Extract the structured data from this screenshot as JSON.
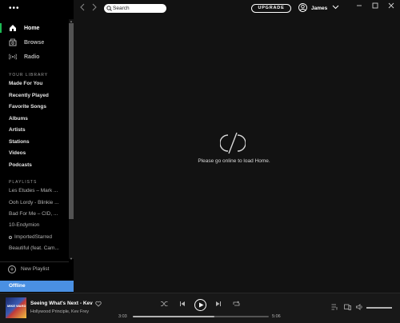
{
  "app": {
    "more_menu": "•••"
  },
  "sidebar": {
    "nav": [
      {
        "label": "Home",
        "icon": "home-icon",
        "active": true
      },
      {
        "label": "Browse",
        "icon": "browse-icon",
        "active": false
      },
      {
        "label": "Radio",
        "icon": "radio-icon",
        "active": false
      }
    ],
    "library_title": "YOUR LIBRARY",
    "library": [
      "Made For You",
      "Recently Played",
      "Favorite Songs",
      "Albums",
      "Artists",
      "Stations",
      "Videos",
      "Podcasts"
    ],
    "playlists_title": "PLAYLISTS",
    "playlists": [
      "Les Etudes – Mark ...",
      "Ooh Lordy - Blinkie ...",
      "Bad For Me – CID, ...",
      "10-Endymion",
      "ImportedStarred",
      "Beautiful (feat. Cam..."
    ],
    "new_playlist": "New Playlist",
    "offline": "Offline"
  },
  "topbar": {
    "search_value": "Search",
    "upgrade": "UPGRADE",
    "user_name": "James"
  },
  "main": {
    "offline_message": "Please go online to load Home."
  },
  "player": {
    "cover_text": "MIKE WARD",
    "title": "Seeing What's Next - Kev Frey Remix",
    "artist": "Hollywood Principle, Kev Frey",
    "elapsed": "3:03",
    "duration": "5:06",
    "progress_fraction": 0.6,
    "volume_fraction": 1.0
  },
  "colors": {
    "accent": "#1db954",
    "offline_banner": "#4a90e2"
  }
}
